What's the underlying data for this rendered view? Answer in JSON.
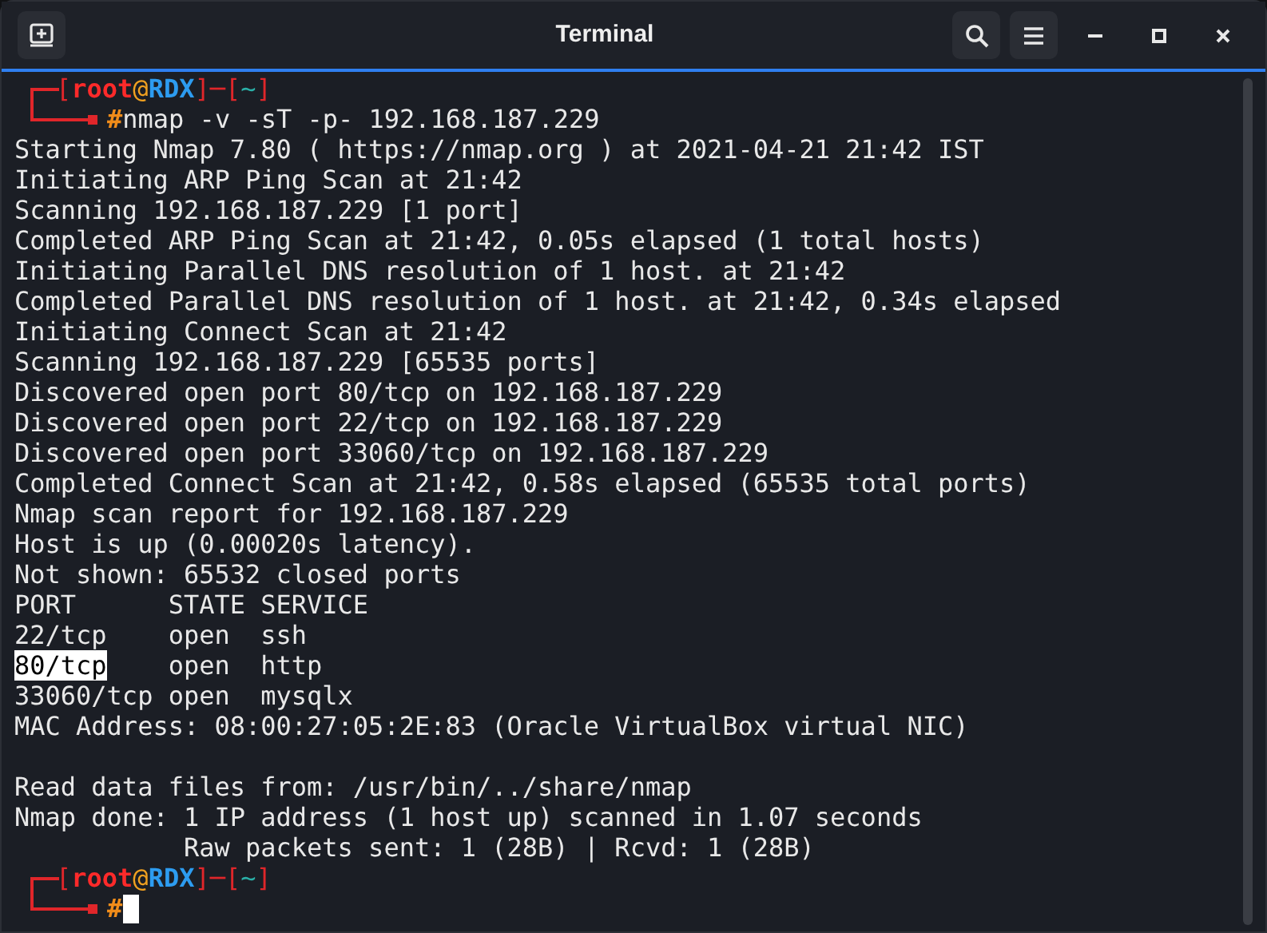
{
  "window": {
    "title": "Terminal"
  },
  "prompts": [
    {
      "segments": [
        {
          "kind": "bracket",
          "text": "["
        },
        {
          "kind": "user",
          "text": "root"
        },
        {
          "kind": "at",
          "text": "@"
        },
        {
          "kind": "host",
          "text": "RDX"
        },
        {
          "kind": "bracket",
          "text": "]"
        },
        {
          "kind": "bracket",
          "text": "─"
        },
        {
          "kind": "bracket",
          "text": "["
        },
        {
          "kind": "dir",
          "text": "~"
        },
        {
          "kind": "bracket",
          "text": "]"
        }
      ],
      "symbol": "#",
      "command": "nmap -v -sT -p- 192.168.187.229",
      "cursor": false,
      "output": [
        {
          "kind": "text",
          "text": "Starting Nmap 7.80 ( https://nmap.org ) at 2021-04-21 21:42 IST"
        },
        {
          "kind": "text",
          "text": "Initiating ARP Ping Scan at 21:42"
        },
        {
          "kind": "text",
          "text": "Scanning 192.168.187.229 [1 port]"
        },
        {
          "kind": "text",
          "text": "Completed ARP Ping Scan at 21:42, 0.05s elapsed (1 total hosts)"
        },
        {
          "kind": "text",
          "text": "Initiating Parallel DNS resolution of 1 host. at 21:42"
        },
        {
          "kind": "text",
          "text": "Completed Parallel DNS resolution of 1 host. at 21:42, 0.34s elapsed"
        },
        {
          "kind": "text",
          "text": "Initiating Connect Scan at 21:42"
        },
        {
          "kind": "text",
          "text": "Scanning 192.168.187.229 [65535 ports]"
        },
        {
          "kind": "text",
          "text": "Discovered open port 80/tcp on 192.168.187.229"
        },
        {
          "kind": "text",
          "text": "Discovered open port 22/tcp on 192.168.187.229"
        },
        {
          "kind": "text",
          "text": "Discovered open port 33060/tcp on 192.168.187.229"
        },
        {
          "kind": "text",
          "text": "Completed Connect Scan at 21:42, 0.58s elapsed (65535 total ports)"
        },
        {
          "kind": "text",
          "text": "Nmap scan report for 192.168.187.229"
        },
        {
          "kind": "text",
          "text": "Host is up (0.00020s latency)."
        },
        {
          "kind": "text",
          "text": "Not shown: 65532 closed ports"
        },
        {
          "kind": "text",
          "text": "PORT      STATE SERVICE"
        },
        {
          "kind": "text",
          "text": "22/tcp    open  ssh"
        },
        {
          "kind": "selection",
          "selected_text": "80/tcp",
          "text": "    open  http"
        },
        {
          "kind": "text",
          "text": "33060/tcp open  mysqlx"
        },
        {
          "kind": "text",
          "text": "MAC Address: 08:00:27:05:2E:83 (Oracle VirtualBox virtual NIC)"
        },
        {
          "kind": "blank"
        },
        {
          "kind": "text",
          "text": "Read data files from: /usr/bin/../share/nmap"
        },
        {
          "kind": "text",
          "text": "Nmap done: 1 IP address (1 host up) scanned in 1.07 seconds"
        },
        {
          "kind": "text",
          "text": "           Raw packets sent: 1 (28B) | Rcvd: 1 (28B)"
        }
      ]
    },
    {
      "segments": [
        {
          "kind": "bracket",
          "text": "["
        },
        {
          "kind": "user",
          "text": "root"
        },
        {
          "kind": "at",
          "text": "@"
        },
        {
          "kind": "host",
          "text": "RDX"
        },
        {
          "kind": "bracket",
          "text": "]"
        },
        {
          "kind": "bracket",
          "text": "─"
        },
        {
          "kind": "bracket",
          "text": "["
        },
        {
          "kind": "dir",
          "text": "~"
        },
        {
          "kind": "bracket",
          "text": "]"
        }
      ],
      "symbol": "#",
      "cursor": true
    }
  ]
}
